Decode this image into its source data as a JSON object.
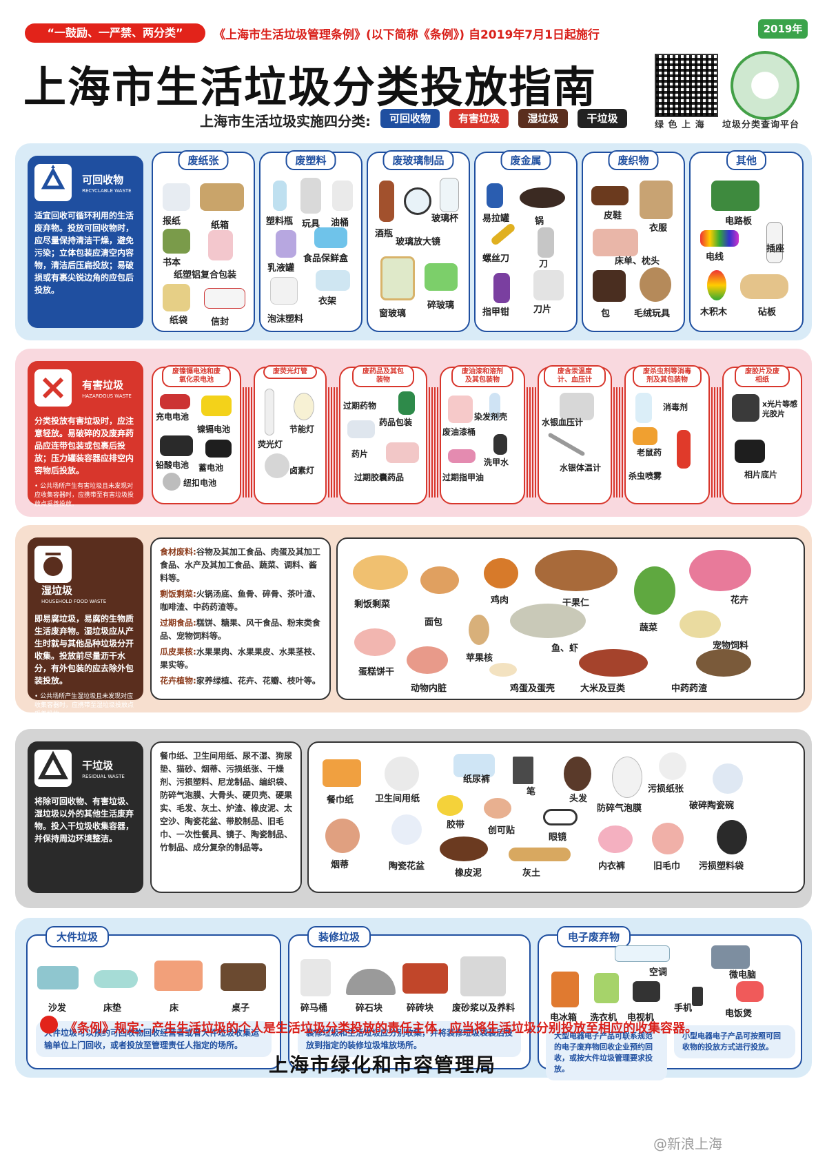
{
  "header": {
    "slogan": "“一鼓励、一严禁、两分类”",
    "decree": "《上海市生活垃圾管理条例》(以下简称《条例》) 自2019年7月1日起施行",
    "year": "2019年",
    "title": "上海市生活垃圾分类投放指南",
    "subtitle": "上海市生活垃圾实施四分类:",
    "categories": [
      "可回收物",
      "有害垃圾",
      "湿垃圾",
      "干垃圾"
    ],
    "qr_label_left": "绿 色 上 海",
    "qr_label_right": "垃圾分类查询平台"
  },
  "recyclable": {
    "name": "可回收物",
    "en": "RECYCLABLE WASTE",
    "desc": "适宜回收可循环利用的生活废弃物。投放可回收物时，应尽量保持清洁干燥，避免污染；立体包装应清空内容物，清洁后压扁投放；易破损或有裹尖锐边角的应包后投放。",
    "groups": [
      {
        "title": "废纸张",
        "items": [
          "报纸",
          "纸箱",
          "书本",
          "纸塑铝复合包装",
          "纸袋",
          "信封"
        ]
      },
      {
        "title": "废塑料",
        "items": [
          "塑料瓶",
          "玩具",
          "油桶",
          "乳液罐",
          "食品保鲜盒",
          "泡沫塑料",
          "衣架"
        ]
      },
      {
        "title": "废玻璃制品",
        "items": [
          "酒瓶",
          "玻璃杯",
          "玻璃放大镜",
          "窗玻璃",
          "碎玻璃"
        ]
      },
      {
        "title": "废金属",
        "items": [
          "易拉罐",
          "锅",
          "螺丝刀",
          "刀",
          "指甲钳",
          "刀片"
        ]
      },
      {
        "title": "废织物",
        "items": [
          "皮鞋",
          "衣服",
          "床单、枕头",
          "包",
          "毛绒玩具"
        ]
      },
      {
        "title": "其他",
        "items": [
          "电路板",
          "电线",
          "插座",
          "木积木",
          "砧板"
        ]
      }
    ]
  },
  "hazardous": {
    "name": "有害垃圾",
    "en": "HAZARDOUS WASTE",
    "desc": "分类投放有害垃圾时，应注意轻放。易破碎的及废弃药品应连带包装或包裹后投放；压力罐装容器应排空内容物后投放。",
    "note": "• 公共场所产生有害垃圾且未发现对应收集容器时，应携带至有害垃圾投放点妥善投放。",
    "groups": [
      {
        "title": "废镍镉电池和废氧化汞电池",
        "items": [
          "充电电池",
          "镍镉电池",
          "铅酸电池",
          "蓄电池",
          "纽扣电池"
        ]
      },
      {
        "title": "废荧光灯管",
        "items": [
          "荧光灯",
          "节能灯",
          "卤素灯"
        ]
      },
      {
        "title": "废药品及其包装物",
        "items": [
          "过期药物",
          "药品包装",
          "药片",
          "过期胶囊药品"
        ]
      },
      {
        "title": "废油漆和溶剂及其包装物",
        "items": [
          "染发剂壳",
          "废油漆桶",
          "洗甲水",
          "过期指甲油"
        ]
      },
      {
        "title": "废含汞温度计、血压计",
        "items": [
          "水银血压计",
          "水银体温计"
        ]
      },
      {
        "title": "废杀虫剂等消毒剂及其包装物",
        "items": [
          "消毒剂",
          "老鼠药",
          "杀虫喷雾"
        ]
      },
      {
        "title": "废胶片及废相纸",
        "items": [
          "x光片等感光胶片",
          "相片底片"
        ]
      }
    ]
  },
  "food": {
    "name": "湿垃圾",
    "en": "HOUSEHOLD FOOD WASTE",
    "desc": "即易腐垃圾，易腐的生物质生活废弃物。湿垃圾应从产生时就与其他品种垃圾分开收集。投放前尽量沥干水分，有外包装的应去除外包装投放。",
    "note": "• 公共场所产生湿垃圾且未发现对应收集容器时，应携带至湿垃圾投放点妥善投放。",
    "lines": [
      {
        "k": "食材废料:",
        "v": "谷物及其加工食品、肉蛋及其加工食品、水产及其加工食品、蔬菜、调料、酱料等。"
      },
      {
        "k": "剩饭剩菜:",
        "v": "火锅汤底、鱼骨、碎骨、茶叶渣、咖啡渣、中药药渣等。"
      },
      {
        "k": "过期食品:",
        "v": "糕饼、糖果、风干食品、粉末类食品、宠物饲料等。"
      },
      {
        "k": "瓜皮果核:",
        "v": "水果果肉、水果果皮、水果茎枝、果实等。"
      },
      {
        "k": "花卉植物:",
        "v": "家养绿植、花卉、花瓣、枝叶等。"
      }
    ],
    "items": [
      "剩饭剩菜",
      "面包",
      "鸡肉",
      "干果仁",
      "花卉",
      "蔬菜",
      "宠物饲料",
      "蛋糕饼干",
      "苹果核",
      "鱼、虾",
      "动物内脏",
      "鸡蛋及蛋壳",
      "大米及豆类",
      "中药药渣"
    ]
  },
  "residual": {
    "name": "干垃圾",
    "en": "RESIDUAL WASTE",
    "desc": "将除可回收物、有害垃圾、湿垃圾以外的其他生活废弃物。投入干垃圾收集容器，并保持周边环境整洁。",
    "text": "餐巾纸、卫生间用纸、尿不湿、狗尿垫、猫砂、烟蒂、污损纸张、干燥剂、污损塑料、尼龙制品、编织袋、防碎气泡膜、大骨头、硬贝壳、硬果实、毛发、灰土、炉渣、橡皮泥、太空沙、陶瓷花盆、带胶制品、旧毛巾、一次性餐具、镜子、陶瓷制品、竹制品、成分复杂的制品等。",
    "items": [
      "餐巾纸",
      "卫生间用纸",
      "纸尿裤",
      "笔",
      "头发",
      "污损纸张",
      "破碎陶瓷碗",
      "胶带",
      "创可贴",
      "眼镜",
      "防碎气泡膜",
      "烟蒂",
      "陶瓷花盆",
      "橡皮泥",
      "灰土",
      "内衣裤",
      "旧毛巾",
      "污损塑料袋"
    ]
  },
  "bulky": {
    "title": "大件垃圾",
    "items": [
      "沙发",
      "床垫",
      "床",
      "桌子"
    ],
    "note": "大件垃圾可以预约可回收物回收经营者或者大件垃圾收集运输单位上门回收，或者投放至管理责任人指定的场所。"
  },
  "renovation": {
    "title": "装修垃圾",
    "items": [
      "碎马桶",
      "碎石块",
      "碎砖块",
      "废砂浆以及养料"
    ],
    "note": "装修垃圾和生活垃圾应分别收集，并将装修垃圾袋装后投放到指定的装修垃圾堆放场所。"
  },
  "ewaste": {
    "title": "电子废弃物",
    "items": [
      "空调",
      "微电脑",
      "电冰箱",
      "洗衣机",
      "电视机",
      "手机",
      "电饭煲"
    ],
    "note_big": "大型电器电子产品可联系规范的电子废弃物回收企业预约回收，或按大件垃圾管理要求投放。",
    "note_small": "小型电器电子产品可按照可回收物的投放方式进行投放。"
  },
  "footer": {
    "regulation": "《条例》规定：产生生活垃圾的个人是生活垃圾分类投放的责任主体，应当将生活垃圾分别投放至相应的收集容器。",
    "authority": "上海市绿化和市容管理局",
    "watermark": "@新浪上海"
  },
  "colors": {
    "recyclable": "#1f4fa0",
    "hazardous": "#d8362c",
    "food": "#5a2e1e",
    "residual": "#2a2a2a"
  }
}
